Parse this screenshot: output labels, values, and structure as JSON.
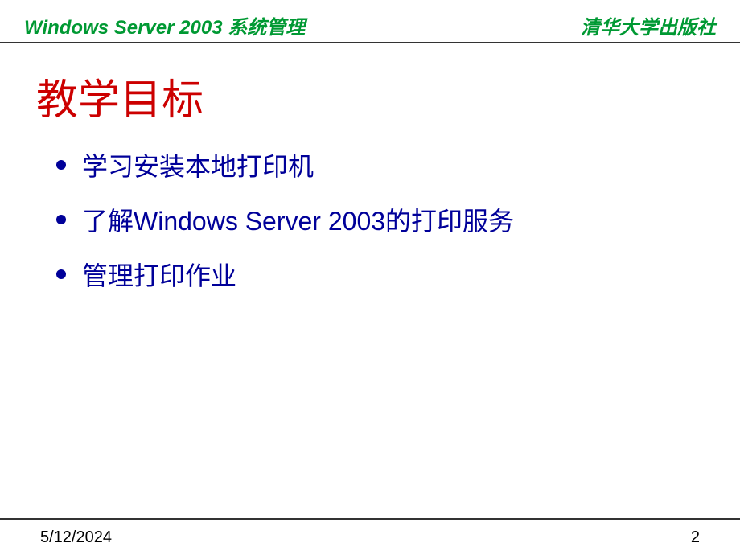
{
  "header": {
    "left": "Windows Server 2003 系统管理",
    "right": "清华大学出版社"
  },
  "title": "教学目标",
  "bullets": [
    "学习安装本地打印机",
    "了解Windows Server 2003的打印服务",
    "管理打印作业"
  ],
  "footer": {
    "date": "5/12/2024",
    "page": "2"
  }
}
